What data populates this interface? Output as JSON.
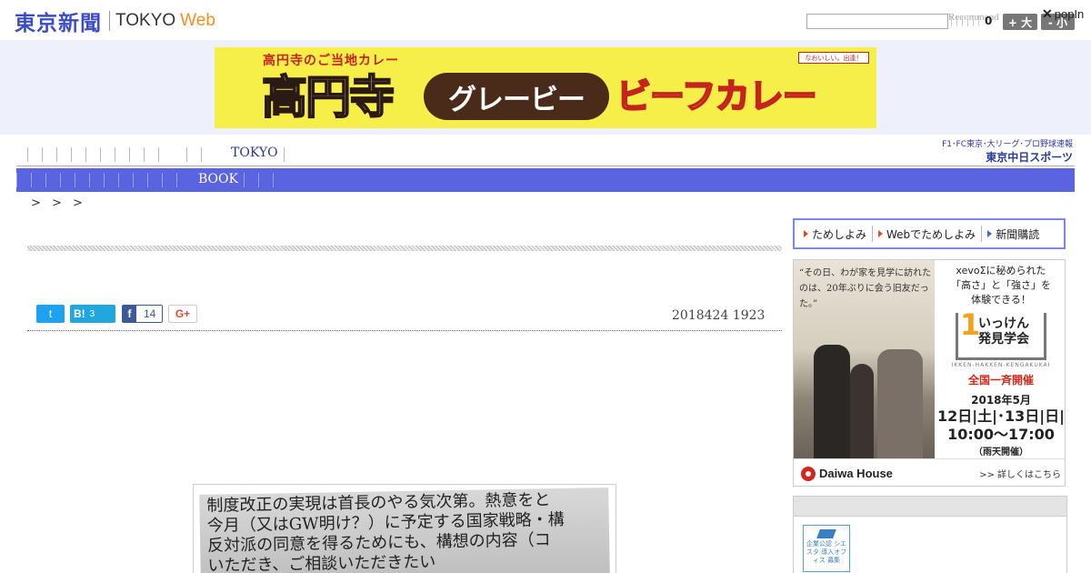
{
  "header": {
    "logo_jp": "東京新聞",
    "logo_en": "TOKYO",
    "logo_web": "Web",
    "search_placeholder": "",
    "recommend_label": "Recommend",
    "recommend_count": "0",
    "font_big": "+ 大",
    "font_small": "- 小",
    "popin_close": "✕",
    "popin_label": "popIn"
  },
  "banner": {
    "sub": "高円寺のご当地カレー",
    "kanji": "高円寺",
    "pill": "グレービー",
    "beef": "ビーフカレー",
    "tag": "なおいしい。出逢！"
  },
  "nav": {
    "tokyo": "TOKYO",
    "book": "BOOK",
    "sponsor_line1": "F1･FC東京･大リーグ･プロ野球速報",
    "sponsor_line2": "東京中日スポーツ"
  },
  "breadcrumb": ">  >  >",
  "share": {
    "twitter": "t",
    "hatena": "B!",
    "hatena_count": "3",
    "facebook": "f",
    "facebook_count": "14",
    "gplus": "G+"
  },
  "article": {
    "date": "2018424 1923",
    "photo_line1": "制度改正の実現は首長のやる気次第。熱意をと",
    "photo_line2": "今月（又はGW明け？）に予定する国家戦略・構",
    "photo_line3": "反対派の同意を得るためにも、構想の内容（コ",
    "photo_line4": "いただき、ご相談いただきたい"
  },
  "right_nav": {
    "items": [
      "ためしよみ",
      "Webでためしよみ",
      "新聞購読"
    ]
  },
  "ad": {
    "quote": "“その日、わが家を見学に訪れたのは、20年ぶりに会う旧友だった。”",
    "headline1": "xevoΣに秘められた",
    "headline2": "「高さ」と「強さ」を",
    "headline3": "体験できる！",
    "event_1": "1",
    "event_name1": "いっけん",
    "event_name2": "発見学会",
    "event_sub": "IKKEN-HAKKEN-KENGAKUKAI",
    "nationwide": "全国一斉開催",
    "year_month": "2018年5月",
    "dates": "12日|土|･13日|日|",
    "time": "10:00〜17:00",
    "rain": "（雨天開催）",
    "brand": "Daiwa House",
    "more": ">> 詳しくはこちら"
  },
  "rbox": {
    "badge": "企業公認 シエスタ 導入オフィス 募集"
  }
}
